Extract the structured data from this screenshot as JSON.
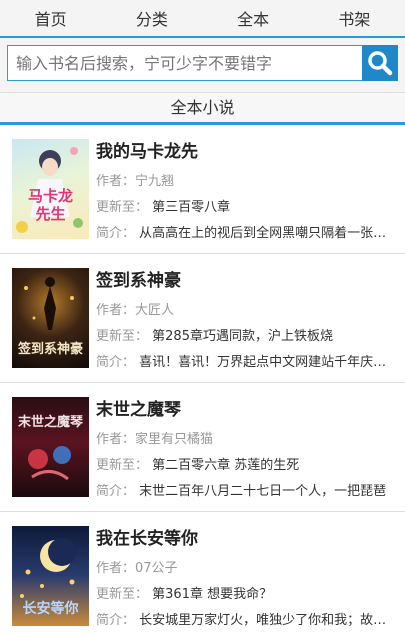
{
  "nav": [
    {
      "label": "首页"
    },
    {
      "label": "分类"
    },
    {
      "label": "全本"
    },
    {
      "label": "书架"
    }
  ],
  "search": {
    "placeholder": "输入书名后搜索，宁可少字不要错字"
  },
  "section": {
    "title": "全本小说"
  },
  "labels": {
    "author": "作者：",
    "update": "更新至：",
    "intro": "简介："
  },
  "books": [
    {
      "title": "我的马卡龙先",
      "author": "宁九翘",
      "update": "第三百零八章",
      "intro": "从高高在上的视后到全网黑嘲只隔着一张床照",
      "cover_text": [
        "马卡龙",
        "先生"
      ]
    },
    {
      "title": "签到系神豪",
      "author": "大匠人",
      "update": "第285章巧遇同款，沪上铁板烧",
      "intro": "喜讯！喜讯！万界起点中文网建站千年庆典活动",
      "cover_text": [
        "签到系神豪"
      ]
    },
    {
      "title": "末世之魔琴",
      "author": "家里有只橘猫",
      "update": "第二百零六章 苏莲的生死",
      "intro": "末世二百年八月二十七日一个人，一把琵琶",
      "cover_text": [
        "末世之魔琴"
      ]
    },
    {
      "title": "我在长安等你",
      "author": "07公子",
      "update": "第361章 想要我命？",
      "intro": "长安城里万家灯火，唯独少了你和我；故人已去",
      "cover_text": [
        "长安等你"
      ]
    }
  ]
}
